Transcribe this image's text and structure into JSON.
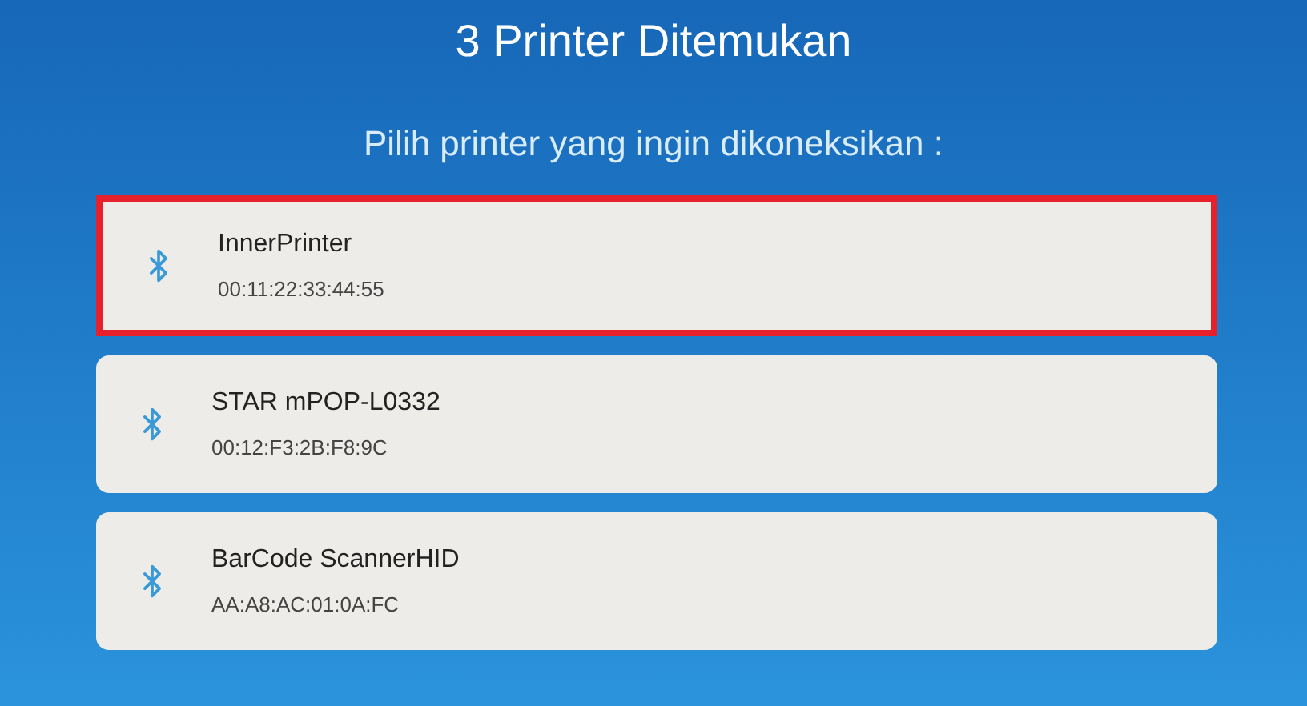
{
  "title": "3 Printer Ditemukan",
  "subtitle": "Pilih printer yang ingin dikoneksikan :",
  "printers": [
    {
      "name": "InnerPrinter",
      "address": "00:11:22:33:44:55",
      "selected": true
    },
    {
      "name": "STAR mPOP-L0332",
      "address": "00:12:F3:2B:F8:9C",
      "selected": false
    },
    {
      "name": "BarCode ScannerHID",
      "address": "AA:A8:AC:01:0A:FC",
      "selected": false
    }
  ]
}
